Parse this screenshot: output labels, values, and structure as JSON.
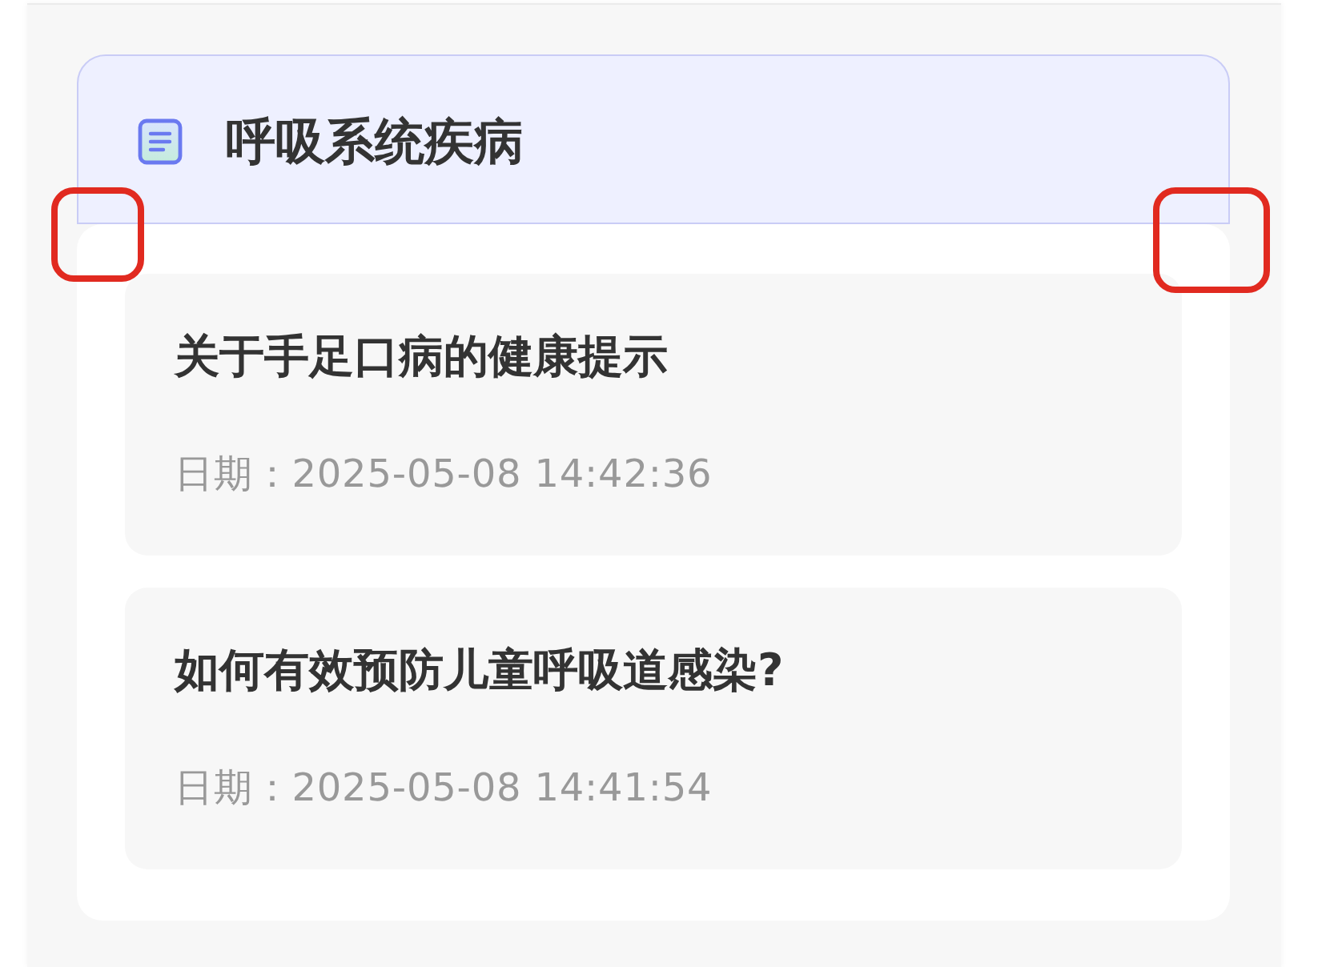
{
  "section": {
    "title": "呼吸系统疾病"
  },
  "articles": [
    {
      "title": "关于手足口病的健康提示",
      "date": "日期：2025-05-08 14:42:36"
    },
    {
      "title": "如何有效预防儿童呼吸道感染?",
      "date": "日期：2025-05-08 14:41:54"
    }
  ],
  "highlights": {
    "left_corner": true,
    "right_corner": true
  }
}
